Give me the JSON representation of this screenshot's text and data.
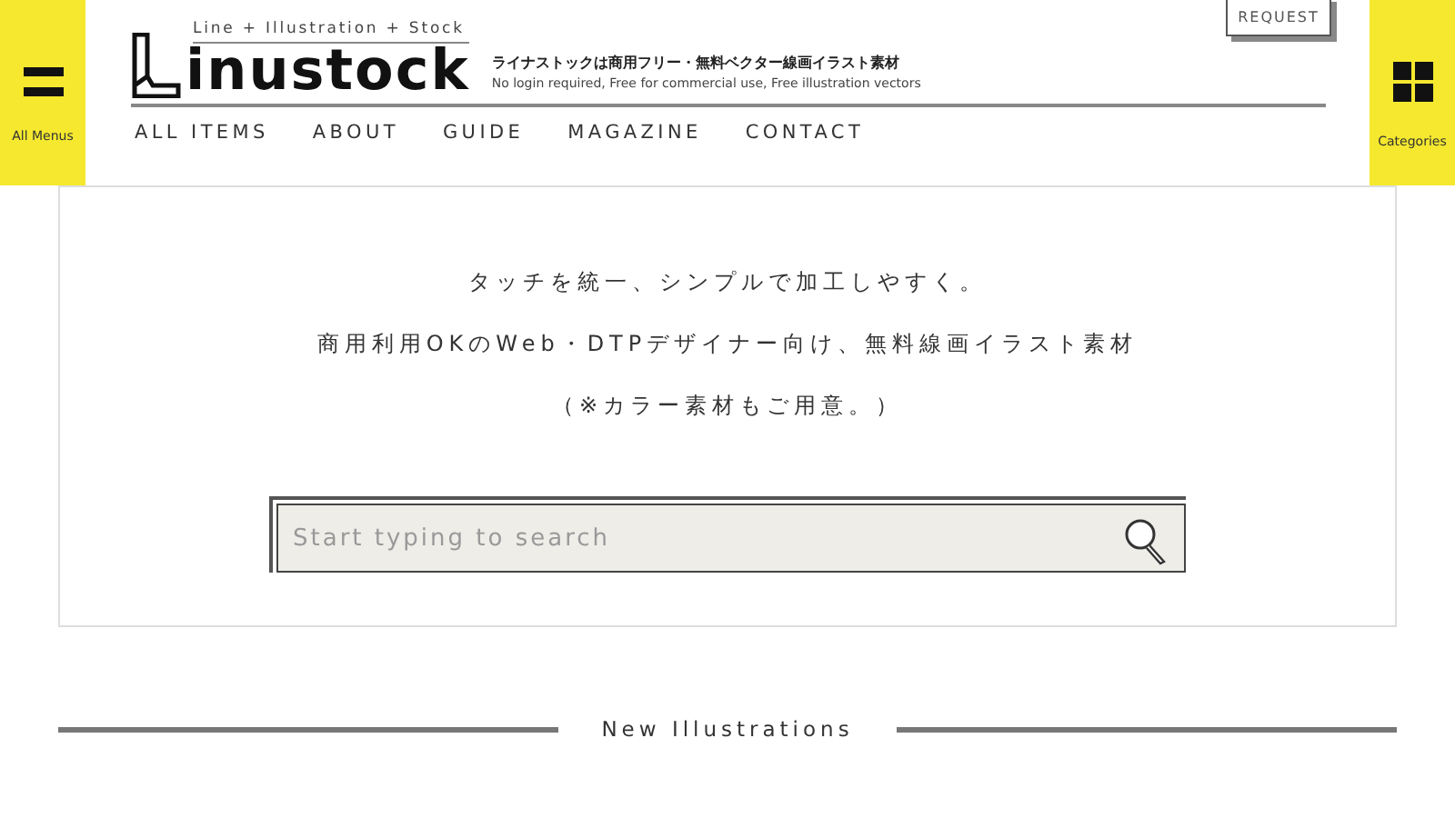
{
  "menu_button": {
    "label": "All Menus"
  },
  "logo": {
    "tagline": "Line + Illustration + Stock",
    "name": "inustock"
  },
  "description": {
    "title": "ライナストックは商用フリー・無料ベクター線画イラスト素材",
    "subtitle": "No login required, Free for commercial use, Free illustration vectors"
  },
  "request_button": {
    "label": "REQUEST"
  },
  "categories_button": {
    "label": "Categories"
  },
  "nav": [
    "ALL ITEMS",
    "ABOUT",
    "GUIDE",
    "MAGAZINE",
    "CONTACT"
  ],
  "intro": [
    "タッチを統一、シンプルで加工しやすく。",
    "商用利用OKのWeb・DTPデザイナー向け、無料線画イラスト素材",
    "（※カラー素材もご用意。）"
  ],
  "search": {
    "placeholder": "Start typing to search"
  },
  "section_heading": "New Illustrations"
}
